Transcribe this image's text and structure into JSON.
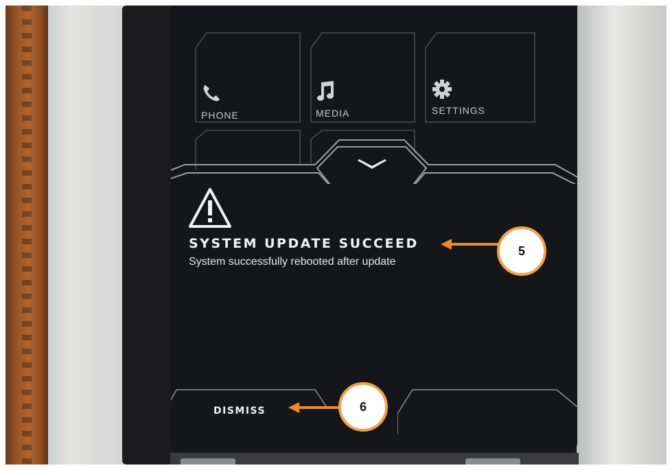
{
  "home_tiles": [
    {
      "label": "PHONE",
      "icon": "phone-icon"
    },
    {
      "label": "MEDIA",
      "icon": "music-note-icon"
    },
    {
      "label": "SETTINGS",
      "icon": "gear-icon"
    }
  ],
  "expand_icon": "chevron-down-icon",
  "alert": {
    "icon": "warning-triangle-icon",
    "title": "SYSTEM UPDATE SUCCEED",
    "message": "System successfully rebooted after update"
  },
  "actions": {
    "dismiss_label": "DISMISS"
  },
  "callouts": [
    {
      "number": "5"
    },
    {
      "number": "6"
    }
  ],
  "colors": {
    "screen_bg": "#141619",
    "callout_border": "#f2a24c",
    "arrow": "#ee8a2c"
  }
}
